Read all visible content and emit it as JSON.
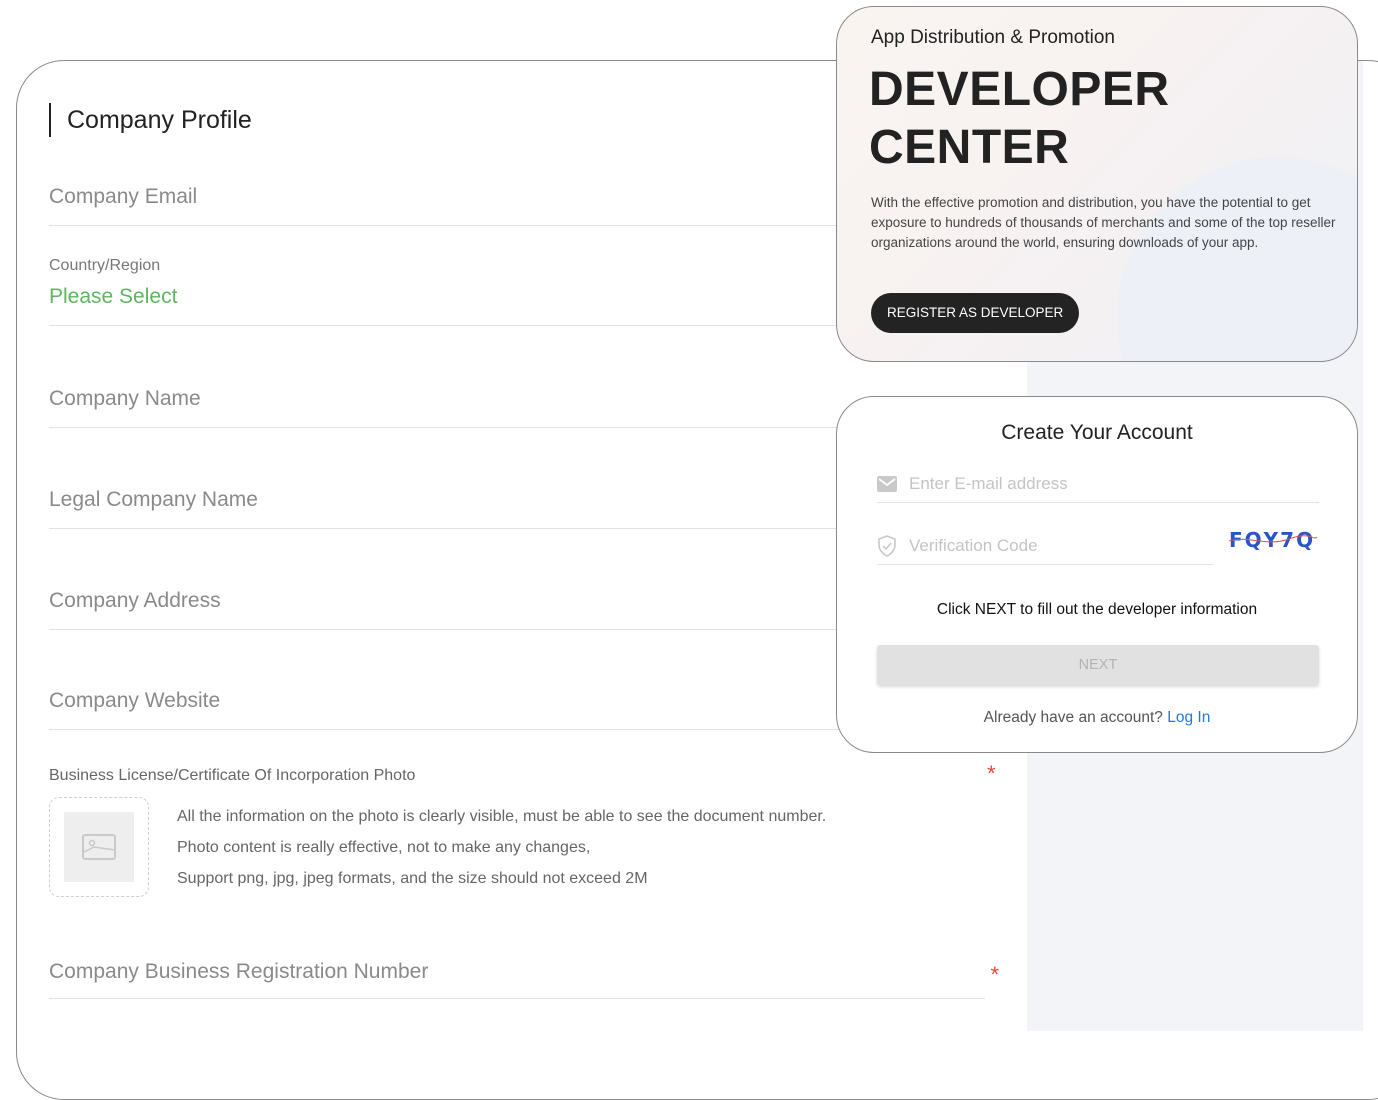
{
  "form": {
    "section_title": "Company Profile",
    "fields": {
      "email": "Company Email",
      "country_label": "Country/Region",
      "country_value": "Please Select",
      "name": "Company Name",
      "legal_name": "Legal Company Name",
      "address": "Company Address",
      "website": "Company Website",
      "license_label": "Business License/Certificate Of Incorporation Photo",
      "brn": "Company Business Registration Number"
    },
    "required_mark": "*",
    "license_notes": [
      "All the information on the photo is clearly visible, must be able to see the document number.",
      "Photo content is really effective, not to make any changes,",
      "Support png, jpg, jpeg formats, and the size should not exceed 2M"
    ]
  },
  "developer_center": {
    "eyebrow": "App Distribution & Promotion",
    "title_line1": "DEVELOPER",
    "title_line2": "CENTER",
    "description": "With the effective promotion and distribution, you have the potential to get exposure to hundreds of thousands of merchants and some of the top reseller organizations around the world, ensuring downloads of your app.",
    "register_button": "REGISTER AS DEVELOPER"
  },
  "create_account": {
    "title": "Create Your Account",
    "email_placeholder": "Enter E-mail address",
    "code_placeholder": "Verification Code",
    "captcha_text": "FQY7Q",
    "hint": "Click NEXT to fill out the developer information",
    "next_button": "NEXT",
    "login_prompt": "Already have an account?",
    "login_link": "Log In"
  },
  "colors": {
    "accent_green": "#5fb562",
    "link_blue": "#1f7ae0",
    "required_red": "#e04a3c",
    "dark_button": "#232323"
  }
}
